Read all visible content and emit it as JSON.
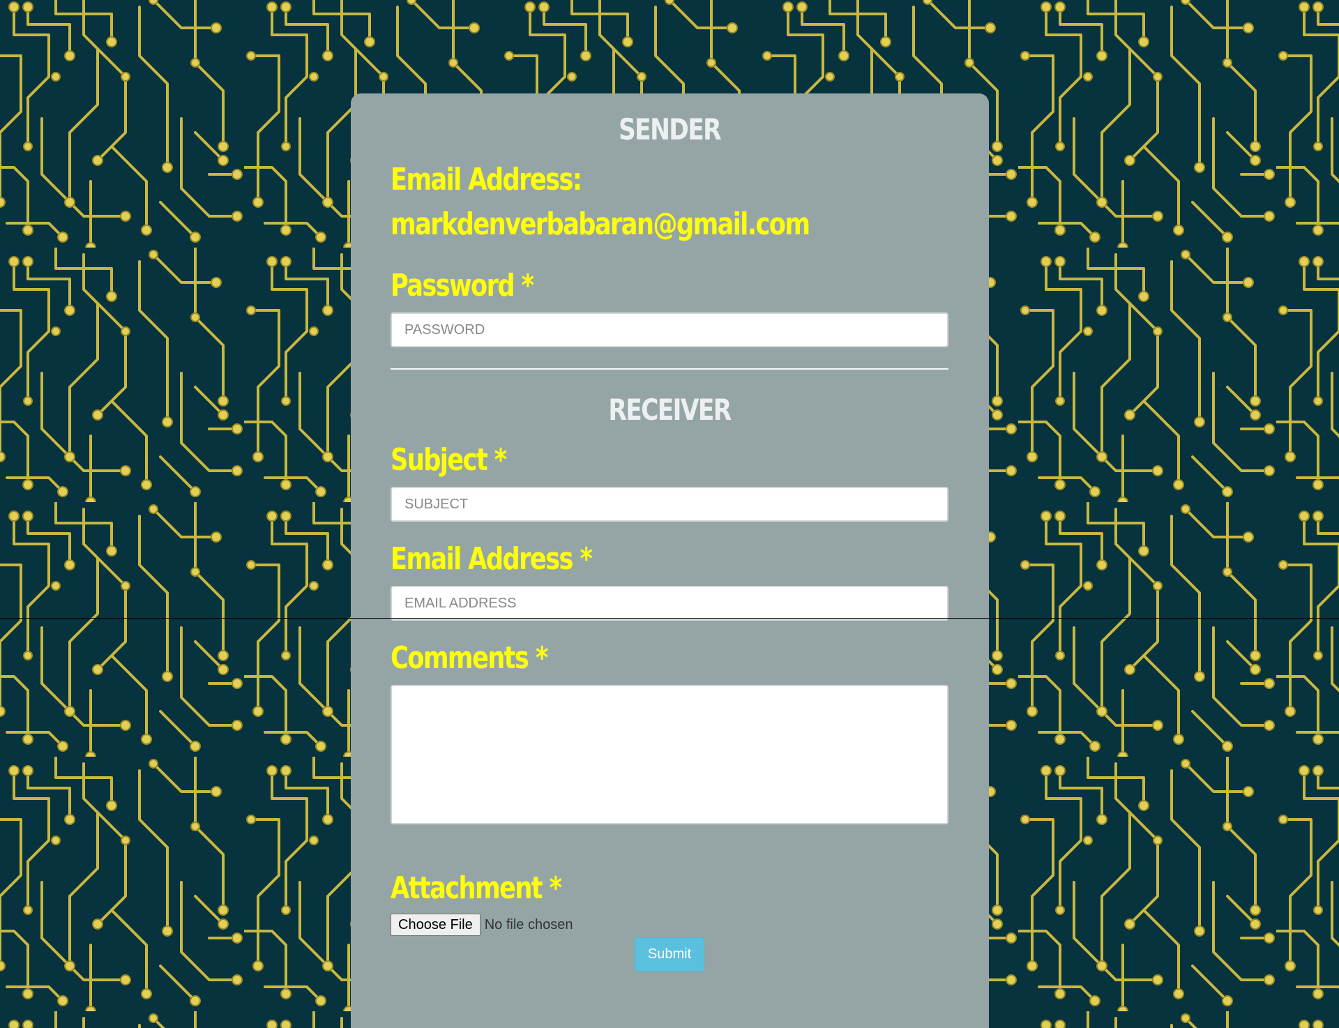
{
  "colors": {
    "background": "#06333d",
    "circuit_trace": "#c9b73f",
    "card": "#95a5a6",
    "label": "#ffff0a",
    "section_title": "#ecf0f1",
    "submit": "#5bc0de"
  },
  "sender": {
    "title": "SENDER",
    "email_label": "Email Address:",
    "email_value": "markdenverbabaran@gmail.com",
    "password_label": "Password *",
    "password_placeholder": "PASSWORD"
  },
  "receiver": {
    "title": "RECEIVER",
    "subject_label": "Subject *",
    "subject_placeholder": "SUBJECT",
    "email_label": "Email Address *",
    "email_placeholder": "EMAIL ADDRESS",
    "comments_label": "Comments *",
    "attachment_label": "Attachment *",
    "choose_file_label": "Choose File",
    "file_status": "No file chosen",
    "submit_label": "Submit"
  }
}
